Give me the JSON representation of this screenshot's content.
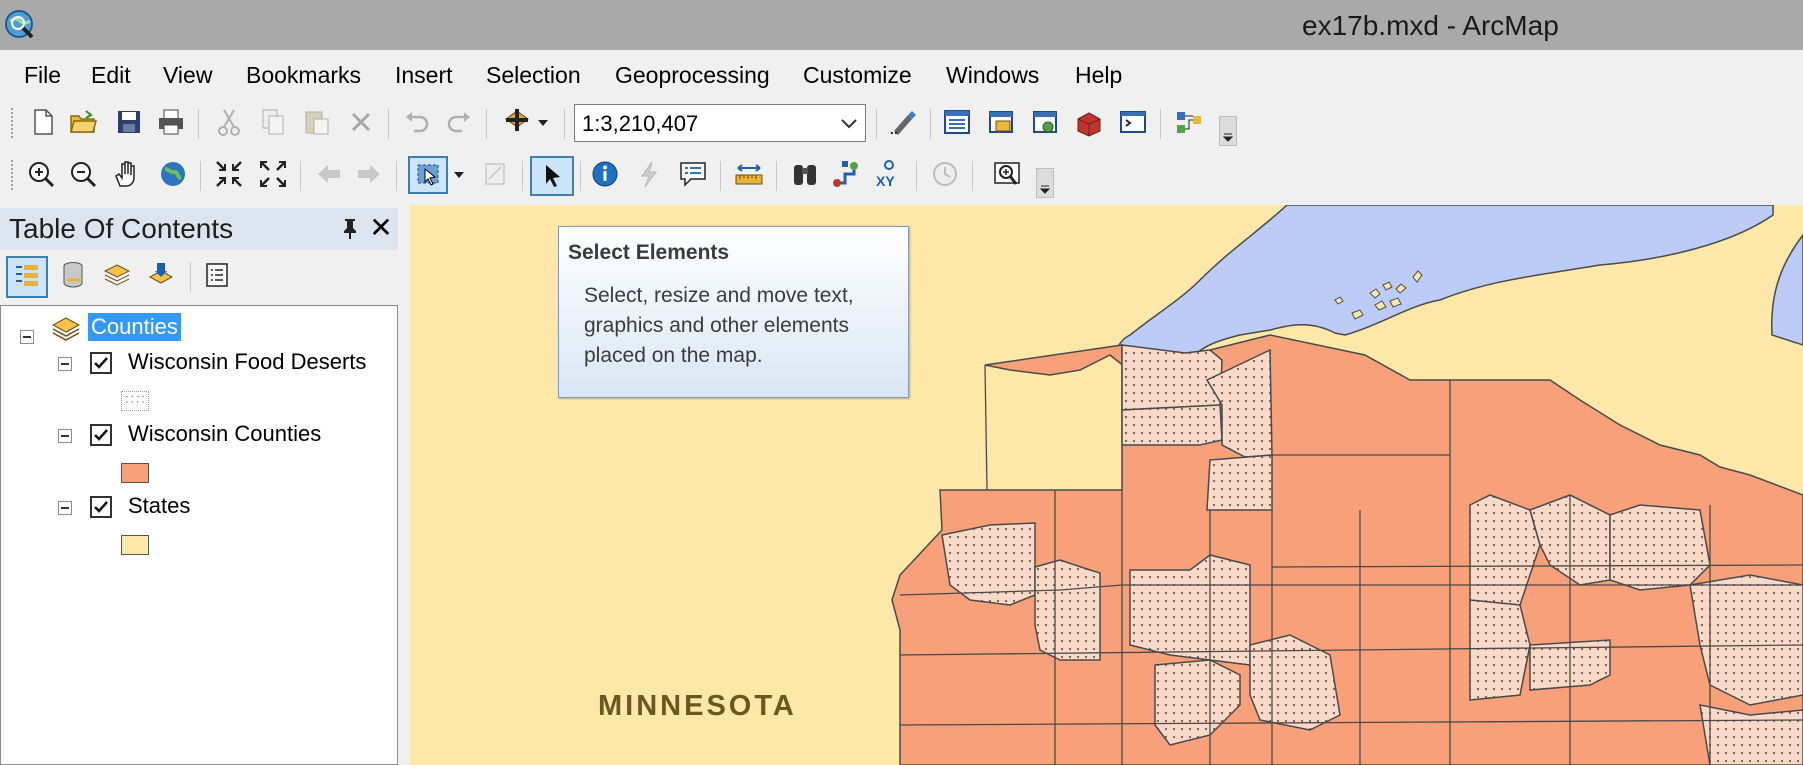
{
  "window": {
    "title": "ex17b.mxd - ArcMap",
    "app_icon": "arcmap-globe-icon"
  },
  "menu": [
    "File",
    "Edit",
    "View",
    "Bookmarks",
    "Insert",
    "Selection",
    "Geoprocessing",
    "Customize",
    "Windows",
    "Help"
  ],
  "standard_toolbar": {
    "icons": [
      "new-document-icon",
      "open-folder-icon",
      "save-icon",
      "print-icon",
      "cut-icon",
      "copy-icon",
      "paste-icon",
      "delete-icon",
      "undo-icon",
      "redo-icon",
      "add-data-icon",
      "editor-toolbar-icon",
      "table-of-contents-icon",
      "catalog-icon",
      "search-window-icon",
      "arctoolbox-icon",
      "python-window-icon",
      "model-builder-icon"
    ],
    "scale": "1:3,210,407"
  },
  "tools_toolbar": {
    "icons": [
      "zoom-in-icon",
      "zoom-out-icon",
      "pan-hand-icon",
      "full-extent-globe-icon",
      "fixed-zoom-in-icon",
      "fixed-zoom-out-icon",
      "back-arrow-icon",
      "forward-arrow-icon",
      "select-features-icon",
      "clear-selection-icon",
      "select-elements-icon",
      "identify-icon",
      "hyperlink-icon",
      "html-popup-icon",
      "measure-icon",
      "find-binoculars-icon",
      "find-route-icon",
      "go-to-xy-icon",
      "time-slider-icon",
      "magnifier-window-icon"
    ],
    "active_tool": "Select Elements"
  },
  "toc": {
    "title": "Table Of Contents",
    "tab_icons": [
      "list-by-drawing-order-icon",
      "list-by-source-icon",
      "list-by-visibility-icon",
      "list-by-selection-icon",
      "options-icon"
    ],
    "data_frame": "Counties",
    "layers": [
      {
        "name": "Wisconsin Food Deserts",
        "checked": true,
        "swatch": "#ffffff",
        "pattern": "dots"
      },
      {
        "name": "Wisconsin Counties",
        "checked": true,
        "swatch": "#f8a07a",
        "pattern": "solid"
      },
      {
        "name": "States",
        "checked": true,
        "swatch": "#fde8aa",
        "pattern": "solid"
      }
    ]
  },
  "tooltip": {
    "title": "Select Elements",
    "body": "Select, resize and move text, graphics and other elements placed on the map."
  },
  "map": {
    "state_label": "MINNESOTA",
    "colors": {
      "states": "#fde8aa",
      "lake": "#bcccf7",
      "counties": "#f8a07a",
      "food_deserts": "#fbd9c9",
      "outline": "#4a4a4a"
    }
  }
}
